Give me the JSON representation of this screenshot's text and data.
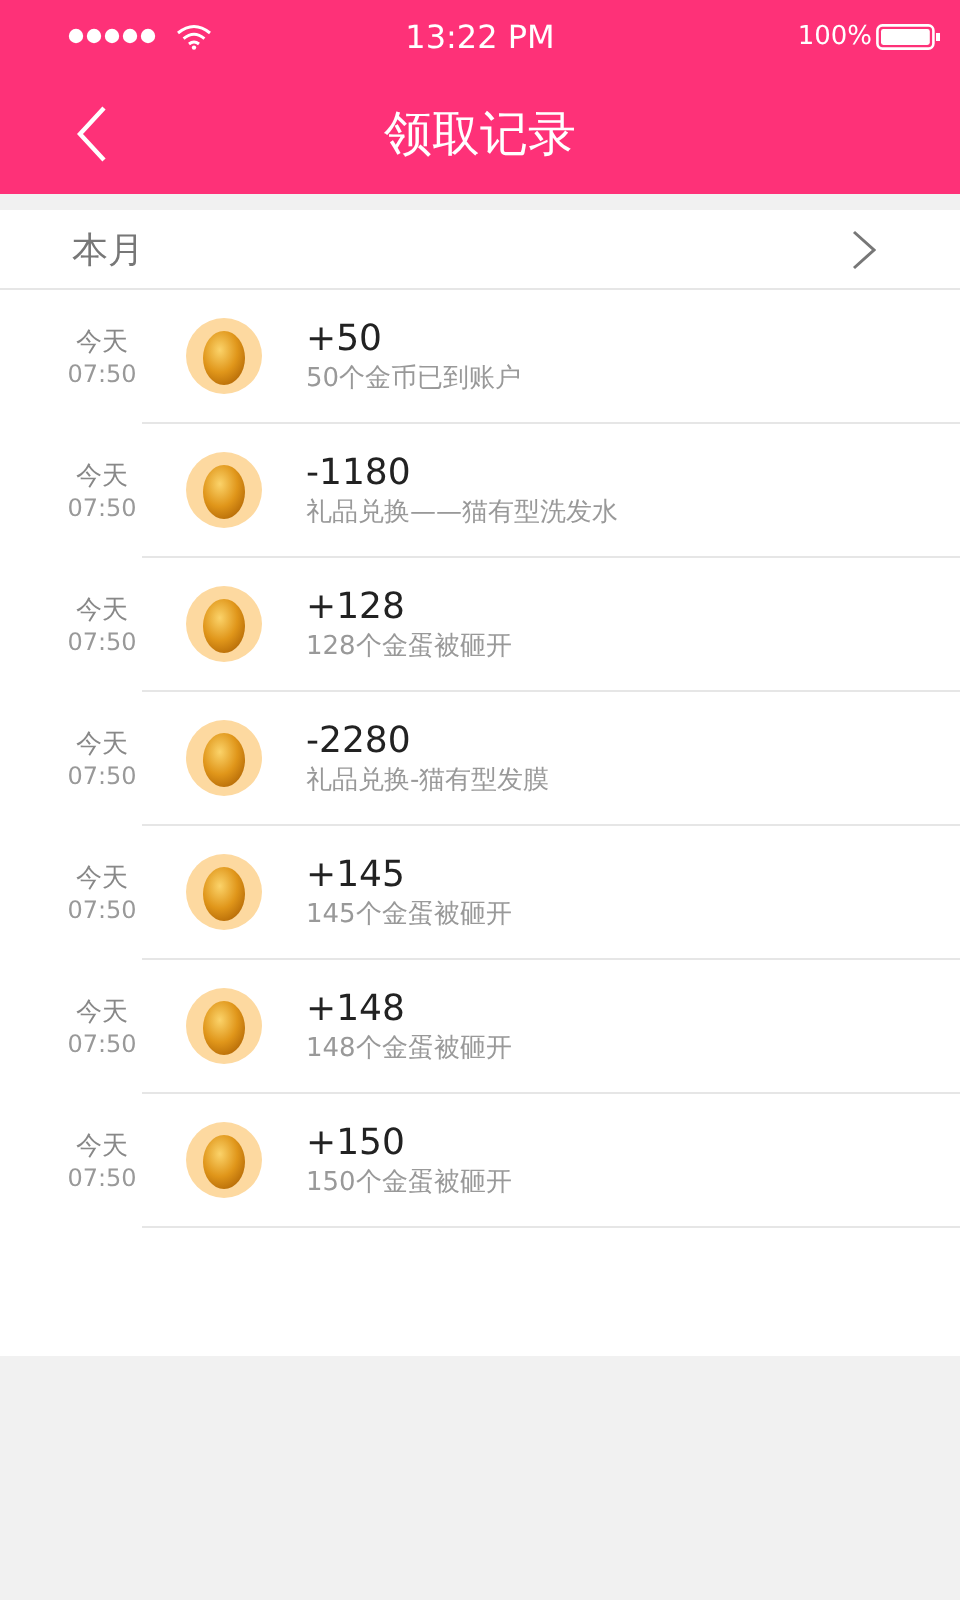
{
  "status_bar": {
    "time": "13:22 PM",
    "battery": "100%"
  },
  "header": {
    "title": "领取记录"
  },
  "month": {
    "label": "本月"
  },
  "records": [
    {
      "day": "今天",
      "time": "07:50",
      "amount": "+50",
      "desc": "50个金币已到账户"
    },
    {
      "day": "今天",
      "time": "07:50",
      "amount": "-1180",
      "desc": "礼品兑换——猫有型洗发水"
    },
    {
      "day": "今天",
      "time": "07:50",
      "amount": "+128",
      "desc": "128个金蛋被砸开"
    },
    {
      "day": "今天",
      "time": "07:50",
      "amount": "-2280",
      "desc": "礼品兑换-猫有型发膜"
    },
    {
      "day": "今天",
      "time": "07:50",
      "amount": "+145",
      "desc": "145个金蛋被砸开"
    },
    {
      "day": "今天",
      "time": "07:50",
      "amount": "+148",
      "desc": "148个金蛋被砸开"
    },
    {
      "day": "今天",
      "time": "07:50",
      "amount": "+150",
      "desc": "150个金蛋被砸开"
    }
  ]
}
